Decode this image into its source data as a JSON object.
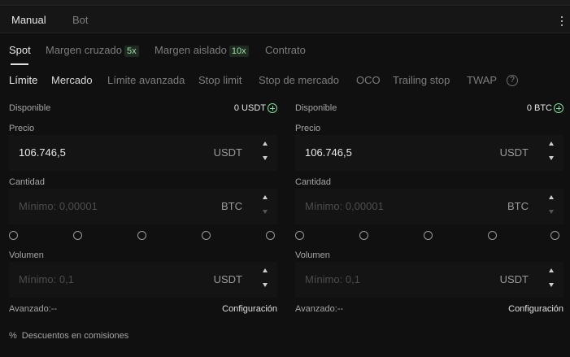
{
  "mode_tabs": [
    {
      "label": "Manual",
      "active": true
    },
    {
      "label": "Bot",
      "active": false
    }
  ],
  "market_tabs": [
    {
      "label": "Spot",
      "active": true
    },
    {
      "label": "Margen cruzado",
      "badge": "5x"
    },
    {
      "label": "Margen aislado",
      "badge": "10x"
    },
    {
      "label": "Contrato"
    }
  ],
  "order_tabs": [
    {
      "label": "Límite",
      "active": true
    },
    {
      "label": "Mercado",
      "active": false
    },
    {
      "label": "Límite avanzada"
    },
    {
      "label": "Stop limit"
    },
    {
      "label": "Stop de mercado"
    },
    {
      "label": "OCO"
    },
    {
      "label": "Trailing stop"
    },
    {
      "label": "TWAP"
    }
  ],
  "help_glyph": "?",
  "buy": {
    "available_label": "Disponible",
    "available_value": "0 USDT",
    "price_label": "Precio",
    "price_value": "106.746,5",
    "price_unit": "USDT",
    "qty_label": "Cantidad",
    "qty_placeholder": "Mínimo: 0,00001",
    "qty_unit": "BTC",
    "volume_label": "Volumen",
    "volume_placeholder": "Mínimo: 0,1",
    "volume_unit": "USDT",
    "advanced_label": "Avanzado:--",
    "config_label": "Configuración"
  },
  "sell": {
    "available_label": "Disponible",
    "available_value": "0 BTC",
    "price_label": "Precio",
    "price_value": "106.746,5",
    "price_unit": "USDT",
    "qty_label": "Cantidad",
    "qty_placeholder": "Mínimo: 0,00001",
    "qty_unit": "BTC",
    "volume_label": "Volumen",
    "volume_placeholder": "Mínimo: 0,1",
    "volume_unit": "USDT",
    "advanced_label": "Avanzado:--",
    "config_label": "Configuración"
  },
  "discount_label": "Descuentos en comisiones",
  "discount_glyph": "%",
  "colors": {
    "background": "#101010",
    "accent_green": "#7fe0a0",
    "text": "#e8e8e8",
    "muted": "#7d7d7d"
  }
}
